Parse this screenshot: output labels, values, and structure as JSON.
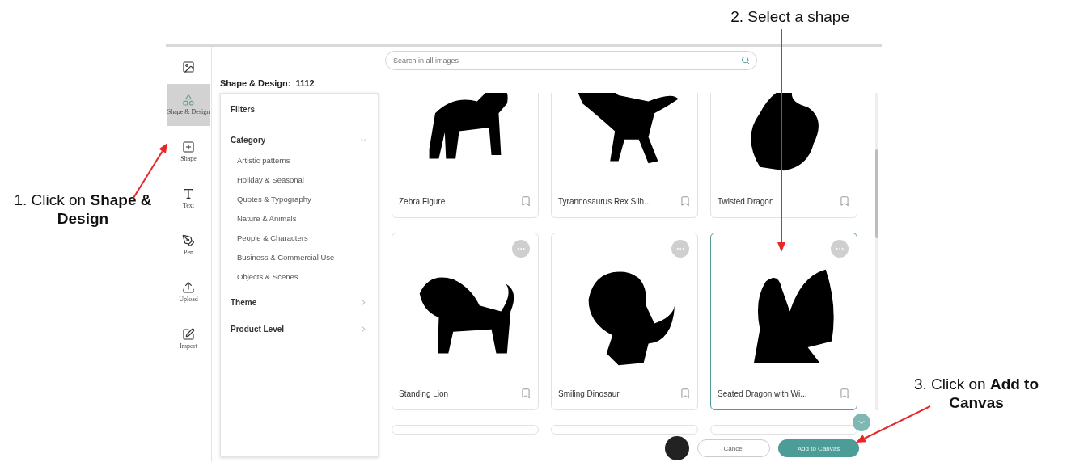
{
  "annotations": [
    {
      "text": "1. Click on **Shape & Design**"
    },
    {
      "text": "2. Select a shape"
    },
    {
      "text": "3. Click on **Add to Canvas**"
    }
  ],
  "sidebar": {
    "items": [
      {
        "kind": "image",
        "selected": false
      },
      {
        "kind": "design",
        "label": "Shape & Design",
        "selected": true
      },
      {
        "kind": "shape",
        "label": "Shape",
        "selected": false
      },
      {
        "kind": "text",
        "label": "Text",
        "selected": false
      },
      {
        "kind": "pen",
        "label": "Pen",
        "selected": false
      },
      {
        "kind": "upload",
        "label": "Upload",
        "selected": false
      },
      {
        "kind": "import",
        "label": "Import",
        "selected": false
      }
    ]
  },
  "search": {
    "placeholder": "Search in all images"
  },
  "heading": {
    "title": "Shape & Design:",
    "count": "1112"
  },
  "filters": {
    "title": "Filters",
    "groups": [
      {
        "label": "Category",
        "expanded": true,
        "options": [
          "Artistic patterns",
          "Holiday & Seasonal",
          "Quotes & Typography",
          "Nature & Animals",
          "People & Characters",
          "Business & Commercial Use",
          "Objects & Scenes"
        ]
      },
      {
        "label": "Theme",
        "expanded": false
      },
      {
        "label": "Product Level",
        "expanded": false
      }
    ]
  },
  "cards": [
    {
      "kind": "full",
      "name": "Zebra Figure",
      "selected": false
    },
    {
      "kind": "full",
      "name": "Tyrannosaurus Rex Silh...",
      "selected": false
    },
    {
      "kind": "full",
      "name": "Twisted Dragon",
      "selected": false
    },
    {
      "kind": "full",
      "name": "Standing Lion",
      "selected": false
    },
    {
      "kind": "full",
      "name": "Smiling Dinosaur",
      "selected": false
    },
    {
      "kind": "full",
      "name": "Seated Dragon with Wi...",
      "selected": true
    },
    {
      "kind": "partial",
      "selected": false
    },
    {
      "kind": "partial",
      "selected": false
    },
    {
      "kind": "partial",
      "selected": false
    }
  ],
  "footer": {
    "cancel": "Cancel",
    "confirm": "Add to Canvas"
  }
}
